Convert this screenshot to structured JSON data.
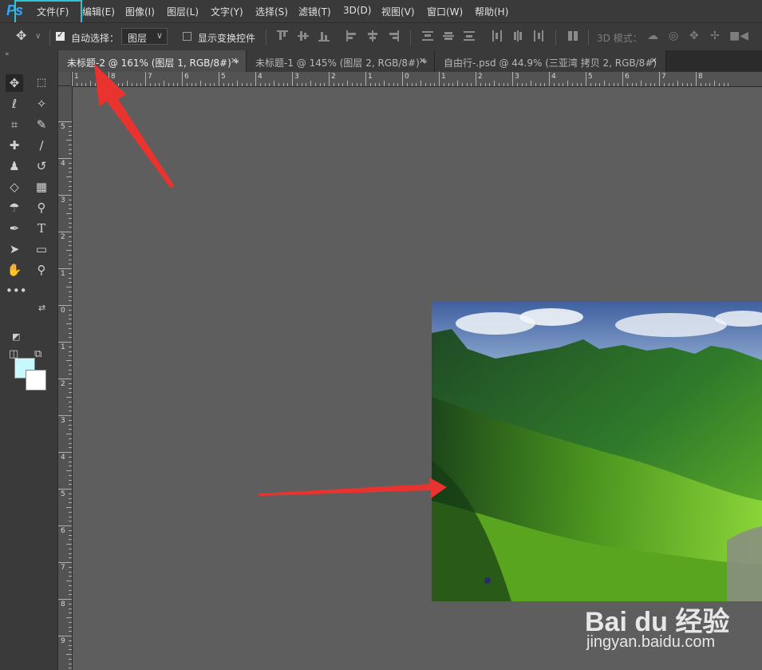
{
  "app": {
    "logo": "Ps"
  },
  "menu": [
    "文件(F)",
    "编辑(E)",
    "图像(I)",
    "图层(L)",
    "文字(Y)",
    "选择(S)",
    "滤镜(T)",
    "3D(D)",
    "视图(V)",
    "窗口(W)",
    "帮助(H)"
  ],
  "options": {
    "auto_select_label": "自动选择：",
    "auto_select_checked": true,
    "layer_select_value": "图层",
    "show_transform_label": "显示变换控件",
    "show_transform_checked": false,
    "mode_3d_label": "3D 模式："
  },
  "tabs": [
    {
      "label": "未标题-2 @ 161% (图层 1, RGB/8#) *",
      "close": "×"
    },
    {
      "label": "未标题-1 @ 145% (图层 2, RGB/8#) *",
      "close": "×"
    },
    {
      "label": "自由行-.psd @ 44.9% (三亚湾 拷贝 2, RGB/8#)",
      "close": "×"
    }
  ],
  "ruler": {
    "top_labels": [
      "1",
      "8",
      "7",
      "6",
      "5",
      "4",
      "3",
      "2",
      "1",
      "0",
      "1",
      "2",
      "3",
      "4",
      "5",
      "6",
      "7",
      "8"
    ],
    "left_labels": [
      "5",
      "4",
      "3",
      "2",
      "1",
      "0",
      "1",
      "2",
      "3",
      "4",
      "5",
      "6",
      "7",
      "8",
      "9"
    ]
  },
  "colors": {
    "foreground": "#c8f8ff",
    "background": "#ffffff",
    "highlight": "#2ec4d4",
    "arrow": "#e8332f"
  },
  "watermark": {
    "logo": "Bai du 经验",
    "url": "jingyan.baidu.com"
  },
  "icons": [
    "move-icon",
    "marquee-icon",
    "lasso-icon",
    "magic-wand-icon",
    "crop-icon",
    "eyedropper-icon",
    "healing-icon",
    "brush-icon",
    "stamp-icon",
    "history-brush-icon",
    "eraser-icon",
    "gradient-icon",
    "blur-icon",
    "dodge-icon",
    "pen-icon",
    "type-icon",
    "path-select-icon",
    "rectangle-icon",
    "hand-icon",
    "zoom-icon",
    "more-tools-icon"
  ]
}
